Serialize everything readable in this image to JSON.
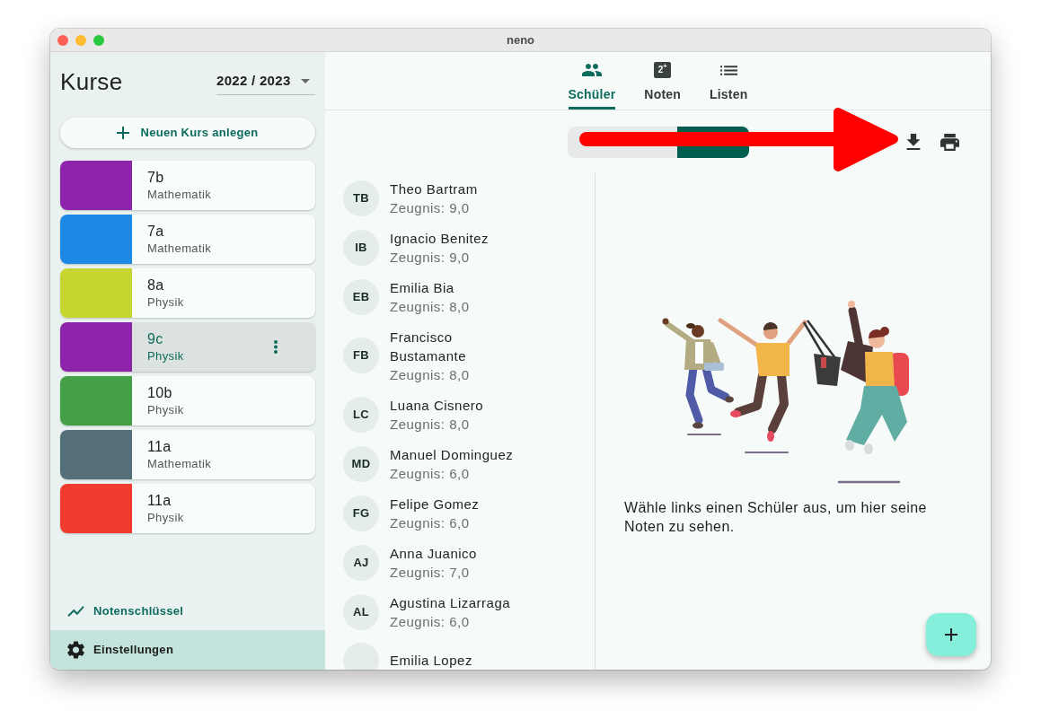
{
  "window": {
    "title": "neno"
  },
  "sidebar": {
    "title": "Kurse",
    "year_select": {
      "value": "2022 / 2023"
    },
    "new_course_button": {
      "label": "Neuen Kurs anlegen"
    },
    "courses": [
      {
        "name": "7b",
        "subject": "Mathematik",
        "color": "#8e24aa",
        "selected": false
      },
      {
        "name": "7a",
        "subject": "Mathematik",
        "color": "#1e88e5",
        "selected": false
      },
      {
        "name": "8a",
        "subject": "Physik",
        "color": "#c6d630",
        "selected": false
      },
      {
        "name": "9c",
        "subject": "Physik",
        "color": "#8e24aa",
        "selected": true
      },
      {
        "name": "10b",
        "subject": "Physik",
        "color": "#43a047",
        "selected": false
      },
      {
        "name": "11a",
        "subject": "Mathematik",
        "color": "#546e7a",
        "selected": false
      },
      {
        "name": "11a",
        "subject": "Physik",
        "color": "#f23b2f",
        "selected": false
      }
    ],
    "footer_items": [
      {
        "label": "Notenschlüssel",
        "kind": "chart",
        "selected": false
      },
      {
        "label": "Einstellungen",
        "kind": "settings",
        "selected": true
      }
    ]
  },
  "tabs": [
    {
      "label": "Schüler",
      "kind": "students",
      "selected": true
    },
    {
      "label": "Noten",
      "kind": "grades",
      "icon_text": "2$^{+}$",
      "selected": false
    },
    {
      "label": "Listen",
      "kind": "lists",
      "selected": false
    }
  ],
  "toolbar": {
    "segments": [
      {
        "selected": false
      },
      {
        "selected": true
      }
    ]
  },
  "students": [
    {
      "initials": "TB",
      "name": "Theo Bartram",
      "grade": "Zeugnis: 9,0"
    },
    {
      "initials": "IB",
      "name": "Ignacio Benitez",
      "grade": "Zeugnis: 9,0"
    },
    {
      "initials": "EB",
      "name": "Emilia Bia",
      "grade": "Zeugnis: 8,0"
    },
    {
      "initials": "FB",
      "name": "Francisco Bustamante",
      "grade": "Zeugnis: 8,0"
    },
    {
      "initials": "LC",
      "name": "Luana Cisnero",
      "grade": "Zeugnis: 8,0"
    },
    {
      "initials": "MD",
      "name": "Manuel Dominguez",
      "grade": "Zeugnis: 6,0"
    },
    {
      "initials": "FG",
      "name": "Felipe Gomez",
      "grade": "Zeugnis: 6,0"
    },
    {
      "initials": "AJ",
      "name": "Anna Juanico",
      "grade": "Zeugnis: 7,0"
    },
    {
      "initials": "AL",
      "name": "Agustina Lizarraga",
      "grade": "Zeugnis: 6,0"
    },
    {
      "name": "Emilia Lopez"
    }
  ],
  "detail": {
    "message": "Wähle links einen Schüler aus, um hier seine Noten zu sehen."
  }
}
